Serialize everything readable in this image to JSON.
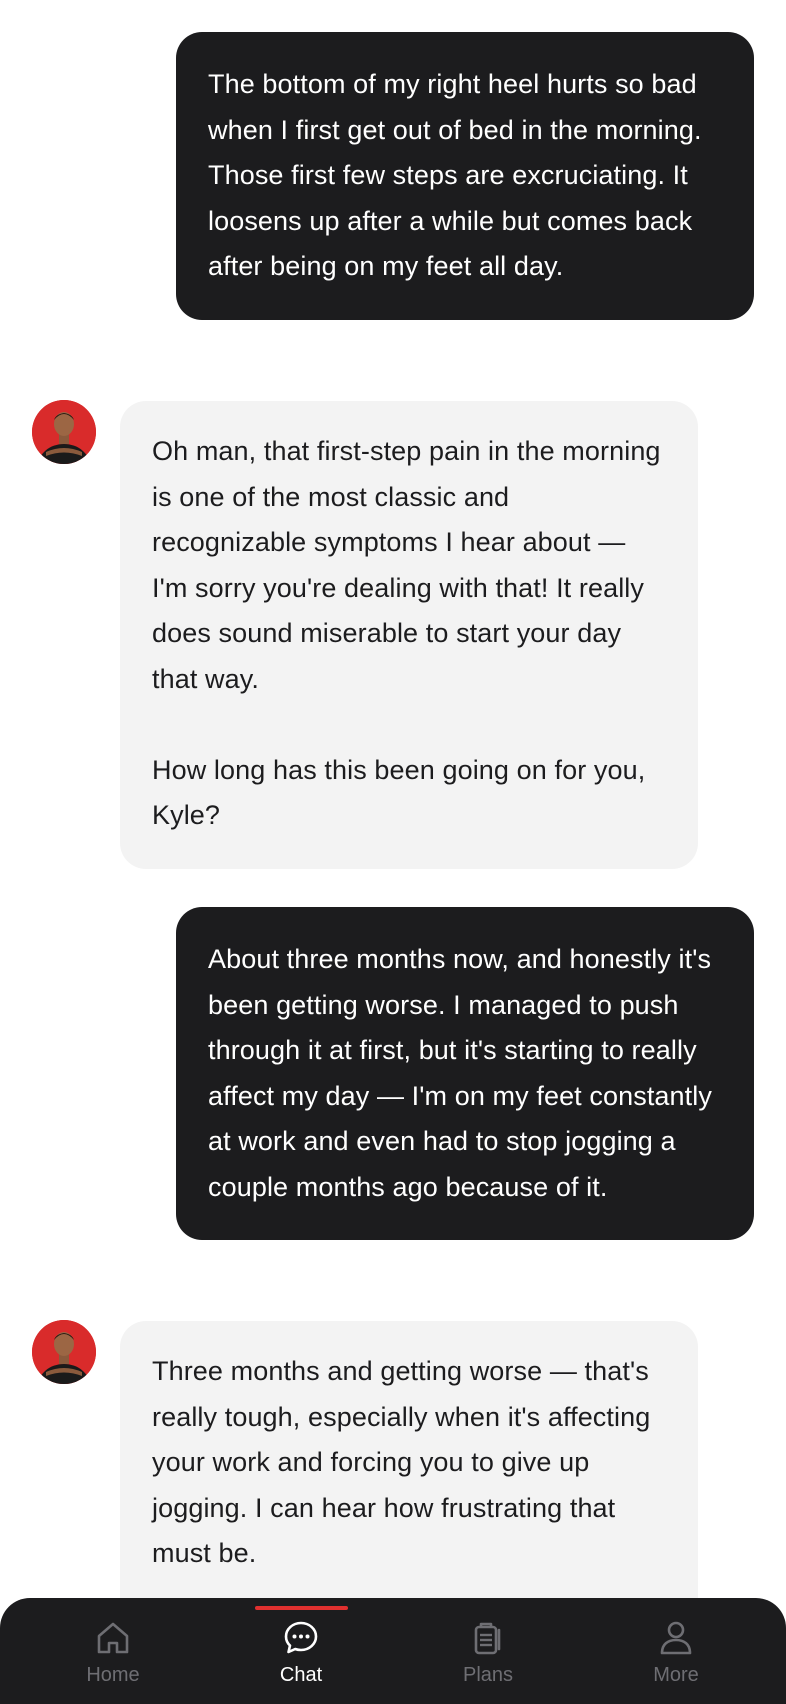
{
  "messages": [
    {
      "sender": "user",
      "text": "The bottom of my right heel hurts so bad when I first get out of bed in the morning. Those first few steps are excruciating. It loosens up after a while but comes back after being on my feet all day."
    },
    {
      "sender": "coach",
      "text": "Oh man, that first-step pain in the morning is one of the most classic and recognizable symptoms I hear about — I'm sorry you're dealing with that! It really does sound miserable to start your day that way.\n\nHow long has this been going on for you, Kyle?"
    },
    {
      "sender": "user",
      "text": "About three months now, and honestly it's been getting worse. I managed to push through it at first, but it's starting to really affect my day — I'm on my feet constantly at work and even had to stop jogging a couple months ago because of it."
    },
    {
      "sender": "coach",
      "text": "Three months and getting worse — that's really tough, especially when it's affecting your work and forcing you to give up jogging. I can hear how frustrating that must be."
    }
  ],
  "tabbar": {
    "active": "Chat",
    "tabs": [
      {
        "label": "Home",
        "icon": "home-icon"
      },
      {
        "label": "Chat",
        "icon": "chat-bubble-icon"
      },
      {
        "label": "Plans",
        "icon": "clipboard-icon"
      },
      {
        "label": "More",
        "icon": "person-icon"
      }
    ]
  },
  "colors": {
    "user_bubble": "#1c1c1e",
    "coach_bubble": "#f3f3f3",
    "accent": "#e0302f",
    "tabbar_bg": "#1c1c1e",
    "tab_inactive": "#6e6e73",
    "avatar_bg": "#d92b2b"
  }
}
